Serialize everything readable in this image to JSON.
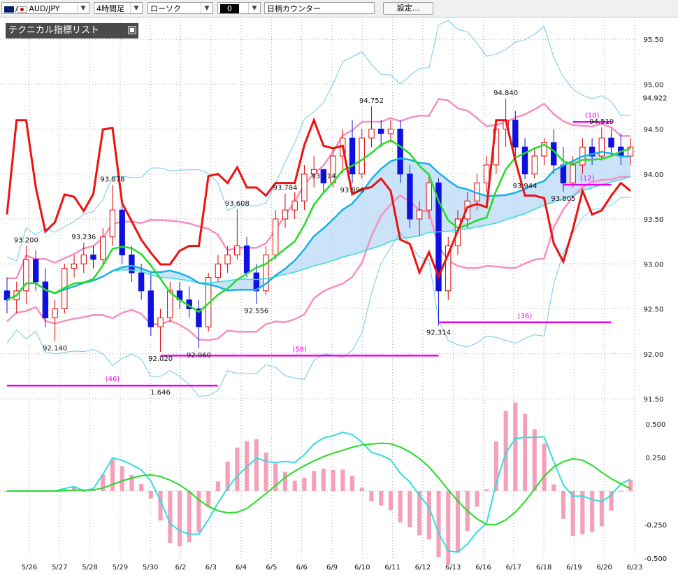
{
  "toolbar": {
    "symbol": "AUD/JPY",
    "timeframe": "4時間足",
    "chart_style": "ローソク",
    "counter_value": "0",
    "counter_label": "日柄カウンター",
    "settings_label": "設定..."
  },
  "indicator_panel": {
    "title": "テクニカル指標リスト"
  },
  "colors": {
    "candle_up": "#e00000",
    "candle_down": "#1010e0",
    "rsi_line": "#ee1111",
    "ma_green": "#22dd22",
    "ma_blue": "#1ab0e8",
    "ma_long": "#33dddd",
    "bb_inner": "#f590c0",
    "bb_outer": "#70c8f0",
    "kumo_blue": "#b8daf5",
    "kumo_pink": "#f8c8d8",
    "counter_line": "#ee00ee",
    "macd_hist": "#f5a0b8"
  },
  "chart_data": {
    "type": "candlestick",
    "price_axis": {
      "ylim": [
        91.5,
        95.62
      ],
      "ticks": [
        "95.50",
        "95.00",
        "94.50",
        "94.00",
        "93.50",
        "93.00",
        "92.50",
        "92.00",
        "91.50"
      ],
      "current": "94.922"
    },
    "macd_axis": {
      "ylim": [
        -0.5,
        0.5
      ],
      "ticks": [
        "0.500",
        "0.250",
        "-0.250",
        "-0.500"
      ]
    },
    "x_labels": [
      "5/26",
      "5/27",
      "5/28",
      "5/29",
      "5/30",
      "6/2",
      "6/3",
      "6/4",
      "6/5",
      "6/6",
      "6/9",
      "6/10",
      "6/11",
      "6/12",
      "6/13",
      "6/16",
      "6/17",
      "6/18",
      "6/19",
      "6/20",
      "6/23"
    ],
    "price_labels": [
      {
        "text": "93.200",
        "value": 93.2
      },
      {
        "text": "92.140",
        "value": 92.14
      },
      {
        "text": "93.236",
        "value": 93.236
      },
      {
        "text": "93.878",
        "value": 93.878
      },
      {
        "text": "92.020",
        "value": 92.02
      },
      {
        "text": "92.060",
        "value": 92.06
      },
      {
        "text": "93.608",
        "value": 93.608
      },
      {
        "text": "92.556",
        "value": 92.556
      },
      {
        "text": "93.784",
        "value": 93.784
      },
      {
        "text": "93.914",
        "value": 93.914
      },
      {
        "text": "93.896",
        "value": 93.896
      },
      {
        "text": "94.752",
        "value": 94.752
      },
      {
        "text": "92.314",
        "value": 92.314
      },
      {
        "text": "94.840",
        "value": 94.84
      },
      {
        "text": "93.944",
        "value": 93.944
      },
      {
        "text": "93.805",
        "value": 93.805
      },
      {
        "text": "94.519",
        "value": 94.519
      },
      {
        "text": "1.646",
        "value": 91.646
      }
    ],
    "counters": [
      {
        "label": "(46)",
        "value": 91.646
      },
      {
        "label": "(58)",
        "value": 91.98
      },
      {
        "label": "(36)",
        "value": 92.35
      },
      {
        "label": "(12)",
        "value": 93.88
      },
      {
        "label": "(10)",
        "value": 94.58
      }
    ],
    "series": [
      {
        "name": "candles",
        "ohlc": [
          [
            92.7,
            92.85,
            92.45,
            92.6
          ],
          [
            92.6,
            92.8,
            92.45,
            92.7
          ],
          [
            92.7,
            93.2,
            92.55,
            93.05
          ],
          [
            93.05,
            93.15,
            92.7,
            92.8
          ],
          [
            92.8,
            92.95,
            92.3,
            92.4
          ],
          [
            92.4,
            92.6,
            92.14,
            92.5
          ],
          [
            92.5,
            93.0,
            92.45,
            92.95
          ],
          [
            92.95,
            93.1,
            92.85,
            93.0
          ],
          [
            93.0,
            93.236,
            92.9,
            93.1
          ],
          [
            93.1,
            93.2,
            92.95,
            93.05
          ],
          [
            93.05,
            93.4,
            93.0,
            93.3
          ],
          [
            93.3,
            93.878,
            93.2,
            93.6
          ],
          [
            93.6,
            93.7,
            93.0,
            93.1
          ],
          [
            93.1,
            93.2,
            92.8,
            92.9
          ],
          [
            92.9,
            93.0,
            92.6,
            92.7
          ],
          [
            92.7,
            92.9,
            92.2,
            92.3
          ],
          [
            92.3,
            92.5,
            92.02,
            92.4
          ],
          [
            92.4,
            92.8,
            92.35,
            92.7
          ],
          [
            92.7,
            92.8,
            92.5,
            92.6
          ],
          [
            92.6,
            92.75,
            92.4,
            92.5
          ],
          [
            92.5,
            92.6,
            92.06,
            92.3
          ],
          [
            92.3,
            92.9,
            92.25,
            92.85
          ],
          [
            92.85,
            93.1,
            92.8,
            93.0
          ],
          [
            93.0,
            93.2,
            92.9,
            93.1
          ],
          [
            93.1,
            93.608,
            93.05,
            93.2
          ],
          [
            93.2,
            93.3,
            92.85,
            92.9
          ],
          [
            92.9,
            93.0,
            92.556,
            92.7
          ],
          [
            92.7,
            93.2,
            92.65,
            93.1
          ],
          [
            93.1,
            93.6,
            93.05,
            93.5
          ],
          [
            93.5,
            93.784,
            93.4,
            93.6
          ],
          [
            93.6,
            93.8,
            93.5,
            93.7
          ],
          [
            93.7,
            94.1,
            93.6,
            94.0
          ],
          [
            94.0,
            94.2,
            93.85,
            94.05
          ],
          [
            94.05,
            93.914,
            93.8,
            93.9
          ],
          [
            93.9,
            94.3,
            93.85,
            94.2
          ],
          [
            94.2,
            94.5,
            94.0,
            94.4
          ],
          [
            94.4,
            94.6,
            93.896,
            94.0
          ],
          [
            94.0,
            94.5,
            93.95,
            94.4
          ],
          [
            94.4,
            94.752,
            94.3,
            94.5
          ],
          [
            94.5,
            94.6,
            94.3,
            94.45
          ],
          [
            94.45,
            94.6,
            94.35,
            94.5
          ],
          [
            94.5,
            94.6,
            93.9,
            94.0
          ],
          [
            94.0,
            94.1,
            93.4,
            93.5
          ],
          [
            93.5,
            93.7,
            93.3,
            93.6
          ],
          [
            93.6,
            94.0,
            93.5,
            93.9
          ],
          [
            93.9,
            93.95,
            92.314,
            92.7
          ],
          [
            92.7,
            93.3,
            92.6,
            93.2
          ],
          [
            93.2,
            93.6,
            93.1,
            93.5
          ],
          [
            93.5,
            93.8,
            93.4,
            93.7
          ],
          [
            93.7,
            94.0,
            93.6,
            93.9
          ],
          [
            93.9,
            94.2,
            93.8,
            94.1
          ],
          [
            94.1,
            94.6,
            94.0,
            94.5
          ],
          [
            94.5,
            94.84,
            94.3,
            94.6
          ],
          [
            94.6,
            94.7,
            94.2,
            94.3
          ],
          [
            94.3,
            94.4,
            93.944,
            94.0
          ],
          [
            94.0,
            94.3,
            93.95,
            94.2
          ],
          [
            94.2,
            94.4,
            94.1,
            94.35
          ],
          [
            94.35,
            94.5,
            94.0,
            94.1
          ],
          [
            94.1,
            94.3,
            93.805,
            93.9
          ],
          [
            93.9,
            94.2,
            93.85,
            94.1
          ],
          [
            94.1,
            94.4,
            94.0,
            94.3
          ],
          [
            94.3,
            94.4,
            94.1,
            94.2
          ],
          [
            94.2,
            94.519,
            94.15,
            94.4
          ],
          [
            94.4,
            94.5,
            94.2,
            94.3
          ],
          [
            94.3,
            94.45,
            94.1,
            94.2
          ],
          [
            94.2,
            94.4,
            94.1,
            94.3
          ]
        ]
      }
    ]
  }
}
